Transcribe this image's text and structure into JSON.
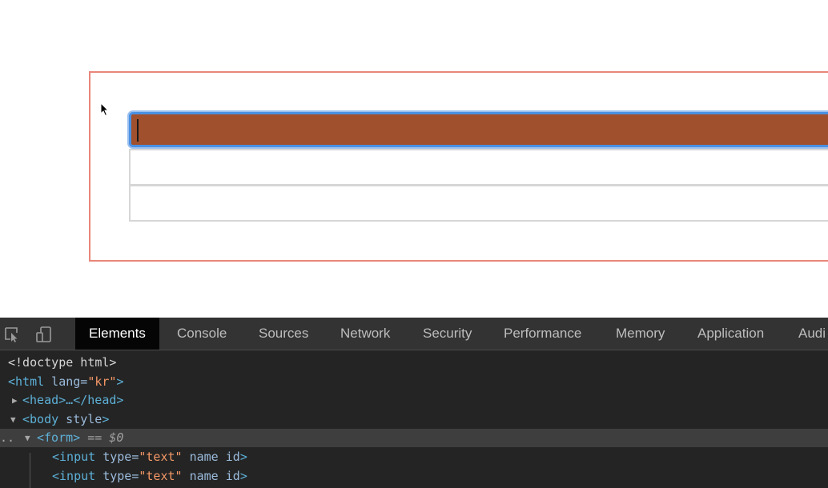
{
  "devtools": {
    "tabs": [
      {
        "label": "Elements",
        "active": true
      },
      {
        "label": "Console"
      },
      {
        "label": "Sources"
      },
      {
        "label": "Network"
      },
      {
        "label": "Security"
      },
      {
        "label": "Performance"
      },
      {
        "label": "Memory"
      },
      {
        "label": "Application"
      },
      {
        "label": "Audi"
      }
    ],
    "dom": {
      "doctype": "<!doctype html>",
      "html_open": "<html",
      "html_attr": " lang=",
      "html_val": "\"kr\"",
      "html_close": ">",
      "head": "<head>…</head>",
      "body_open": "<body",
      "body_attr": " style",
      "body_close": ">",
      "form_tag": "<form>",
      "form_marker": " == $0",
      "input1_open": "<input",
      "input1_attr": " type=",
      "input1_val": "\"text\"",
      "input1_rest": " name id",
      "input1_close": ">",
      "input2_open": "<input",
      "input2_attr": " type=",
      "input2_val": "\"text\"",
      "input2_rest": " name id",
      "input2_close": ">"
    }
  },
  "colors": {
    "focused_input_fill": "#a0502c",
    "focus_ring": "#4a90e2",
    "form_border": "#e8867a"
  }
}
